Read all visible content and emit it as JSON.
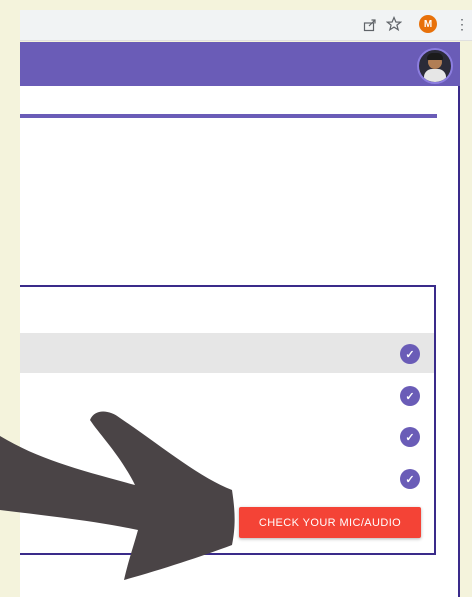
{
  "browser": {
    "share_icon": "share-icon",
    "bookmark_icon": "star-icon",
    "profile_initial": "M",
    "menu_icon": "kebab-menu-icon"
  },
  "header": {
    "accent_color": "#6a5cb7",
    "avatar": "user-avatar"
  },
  "checklist": {
    "check_color": "#6a5cb7",
    "items": [
      {
        "status": "checked",
        "highlighted": true
      },
      {
        "status": "checked",
        "highlighted": false
      },
      {
        "status": "checked",
        "highlighted": false
      },
      {
        "status": "checked",
        "highlighted": false
      }
    ]
  },
  "action": {
    "mic_button_label": "CHECK YOUR MIC/AUDIO",
    "button_color": "#f44336"
  },
  "overlay": {
    "arrow_color": "#4a4446"
  }
}
